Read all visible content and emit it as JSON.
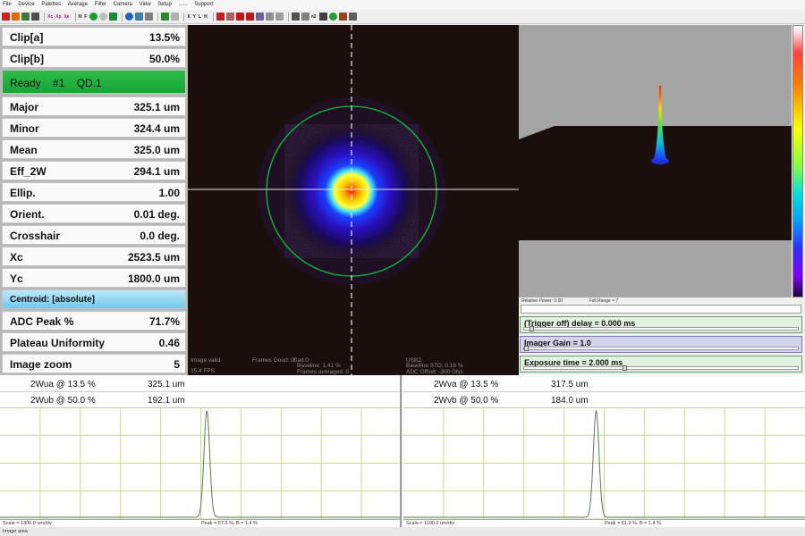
{
  "menu": [
    "File",
    "Device",
    "Palettes",
    "Average",
    "Filter",
    "Camera",
    "View",
    "Setup",
    "......",
    "Support"
  ],
  "toolbar_text": [
    "Xc",
    "Xp",
    "Xe",
    "N",
    "F",
    "X",
    "Y",
    "L",
    "H",
    "n2"
  ],
  "left_panel": {
    "rows": [
      {
        "label": "Clip[a]",
        "value": "13.5%"
      },
      {
        "label": "Clip[b]",
        "value": "50.0%"
      },
      {
        "label": "Ready #1 QD.1",
        "value": ""
      },
      {
        "label": "Major",
        "value": "325.1 um"
      },
      {
        "label": "Minor",
        "value": "324.4 um"
      },
      {
        "label": "Mean",
        "value": "325.0 um"
      },
      {
        "label": "Eff_2W",
        "value": "294.1 um"
      },
      {
        "label": "Ellip.",
        "value": "1.00"
      },
      {
        "label": "Orient.",
        "value": "0.01 deg."
      },
      {
        "label": "Crosshair",
        "value": "0.0 deg."
      },
      {
        "label": "Xc",
        "value": "2523.5 um"
      },
      {
        "label": "Yc",
        "value": "1800.0 um"
      },
      {
        "label": "Centroid: [absolute]",
        "value": ""
      },
      {
        "label": "ADC Peak %",
        "value": "71.7%"
      },
      {
        "label": "Plateau Uniformity",
        "value": "0.46"
      },
      {
        "label": "Image zoom",
        "value": "5"
      }
    ]
  },
  "beam_overlay": {
    "image_valid": "Image valid",
    "fps": "15.4 FPS",
    "frames_good": "Frames Good: 0",
    "bad": "Bad:0",
    "baseline": "Baseline: 1.41 %",
    "frames_averaged": "Frames averaged: 0",
    "usb": "USB2",
    "baseline_std": "Baseline STD: 0.18 %",
    "adc_offset": "ADC Offset: -300 DNs"
  },
  "right_panel": {
    "relative_power": "Relative Power: 0.00",
    "full_range": "Full Range = 7",
    "controls": [
      {
        "label": "(Trigger off) delay = 0.000 ms",
        "color": "#e2f2e0",
        "thumb": 0.02
      },
      {
        "label": "Imager Gain = 1.0",
        "color": "#d4d4ee",
        "thumb": 0.0
      },
      {
        "label": "Exposure time = 2.000 ms",
        "color": "#e2f2e0",
        "thumb": 0.36
      }
    ]
  },
  "profiles": [
    {
      "name": "horizontal",
      "row1_label": "2Wua @ 13.5 %",
      "row1_value": "325.1 um",
      "row2_label": "2Wub @ 50.0 %",
      "row2_value": "192.1 um",
      "scale": "Scale = 1300.0 um/div",
      "peak": "Peak = 57.5 %, B = 1.4 %",
      "peak_position": 0.515
    },
    {
      "name": "vertical",
      "row1_label": "2Wva @ 13.5 %",
      "row1_value": "317.5 um",
      "row2_label": "2Wvb @ 50.0 %",
      "row2_value": "184.0 um",
      "scale": "Scale = 1100.0 um/div",
      "peak": "Peak = 61.9 %, B = 1.4 %",
      "peak_position": 0.48
    }
  ],
  "status_bar": "Image area",
  "colors": {
    "grid": "#c6dd88",
    "profile_line": "#5a7a5a",
    "circle": "#18a23a",
    "ready": "#1fae3e",
    "centroid": "#7ccff2"
  }
}
